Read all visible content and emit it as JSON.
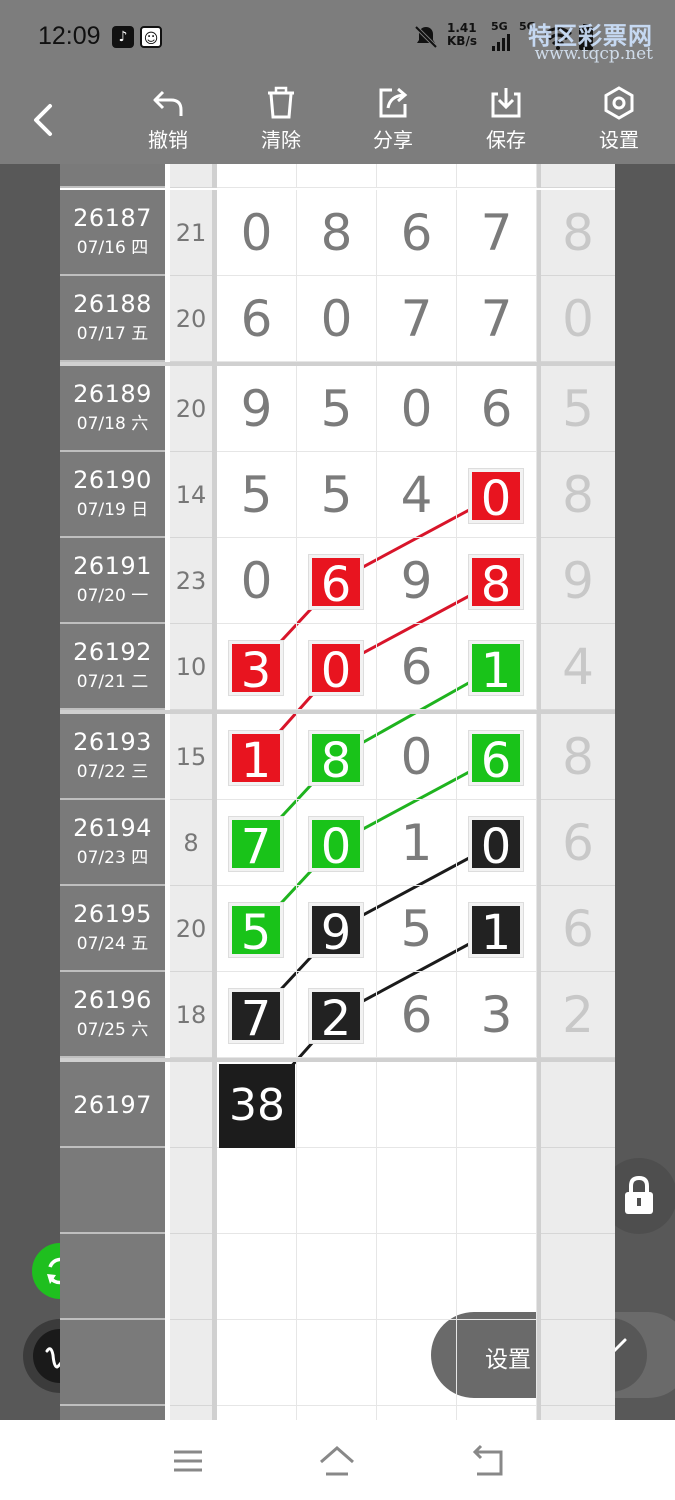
{
  "status_bar": {
    "time": "12:09",
    "speed_value": "1.41",
    "speed_unit": "KB/s",
    "signal_1": "5G",
    "signal_2": "5G",
    "icons": [
      "tiktok-icon",
      "avatar-icon",
      "mute-bell-icon",
      "signal-icon",
      "wifi-icon",
      "battery-icon"
    ]
  },
  "watermark": {
    "name": "特区彩票网",
    "url": "www.tqcp.net"
  },
  "toolbar": {
    "back_icon": "back-arrow-icon",
    "tools": [
      {
        "label": "撤销",
        "icon": "undo-icon"
      },
      {
        "label": "清除",
        "icon": "trash-icon"
      },
      {
        "label": "分享",
        "icon": "share-icon"
      },
      {
        "label": "保存",
        "icon": "download-icon"
      },
      {
        "label": "设置",
        "icon": "hexagon-settings-icon"
      }
    ]
  },
  "grid": {
    "rows": [
      {
        "issue": "26187",
        "date": "07/16 四",
        "sum": "21",
        "digits": [
          "0",
          "8",
          "6",
          "7"
        ],
        "extra": "8",
        "hl": [
          null,
          null,
          null,
          null
        ]
      },
      {
        "issue": "26188",
        "date": "07/17 五",
        "sum": "20",
        "digits": [
          "6",
          "0",
          "7",
          "7"
        ],
        "extra": "0",
        "hl": [
          null,
          null,
          null,
          null
        ]
      },
      {
        "issue": "26189",
        "date": "07/18 六",
        "sum": "20",
        "digits": [
          "9",
          "5",
          "0",
          "6"
        ],
        "extra": "5",
        "hl": [
          null,
          null,
          null,
          null
        ]
      },
      {
        "issue": "26190",
        "date": "07/19 日",
        "sum": "14",
        "digits": [
          "5",
          "5",
          "4",
          "0"
        ],
        "extra": "8",
        "hl": [
          null,
          null,
          null,
          "red"
        ]
      },
      {
        "issue": "26191",
        "date": "07/20 一",
        "sum": "23",
        "digits": [
          "0",
          "6",
          "9",
          "8"
        ],
        "extra": "9",
        "hl": [
          null,
          "red",
          null,
          "red"
        ]
      },
      {
        "issue": "26192",
        "date": "07/21 二",
        "sum": "10",
        "digits": [
          "3",
          "0",
          "6",
          "1"
        ],
        "extra": "4",
        "hl": [
          "red",
          "red",
          null,
          "green"
        ]
      },
      {
        "issue": "26193",
        "date": "07/22 三",
        "sum": "15",
        "digits": [
          "1",
          "8",
          "0",
          "6"
        ],
        "extra": "8",
        "hl": [
          "red",
          "green",
          null,
          "green"
        ]
      },
      {
        "issue": "26194",
        "date": "07/23 四",
        "sum": "8",
        "digits": [
          "7",
          "0",
          "1",
          "0"
        ],
        "extra": "6",
        "hl": [
          "green",
          "green",
          null,
          "black"
        ]
      },
      {
        "issue": "26195",
        "date": "07/24 五",
        "sum": "20",
        "digits": [
          "5",
          "9",
          "5",
          "1"
        ],
        "extra": "6",
        "hl": [
          "green",
          "black",
          null,
          "black"
        ]
      },
      {
        "issue": "26196",
        "date": "07/25 六",
        "sum": "18",
        "digits": [
          "7",
          "2",
          "6",
          "3"
        ],
        "extra": "2",
        "hl": [
          "black",
          "black",
          null,
          null
        ]
      }
    ],
    "next_issue": "26197",
    "prediction": "38"
  },
  "colors": {
    "red": "#e8141f",
    "green": "#19c319",
    "black": "#222222",
    "line_red": "#d8152a",
    "line_green": "#1fb31f",
    "line_black": "#1b1b1b"
  },
  "controls": {
    "refresh_icon": "refresh-icon",
    "pen_icon": "pen-icon",
    "lock_icon": "lock-icon",
    "settings_label": "设置",
    "line_tool_icon": "line-tool-icon"
  },
  "nav_bar": {
    "icons": [
      "menu-icon",
      "home-icon",
      "back-icon"
    ]
  }
}
